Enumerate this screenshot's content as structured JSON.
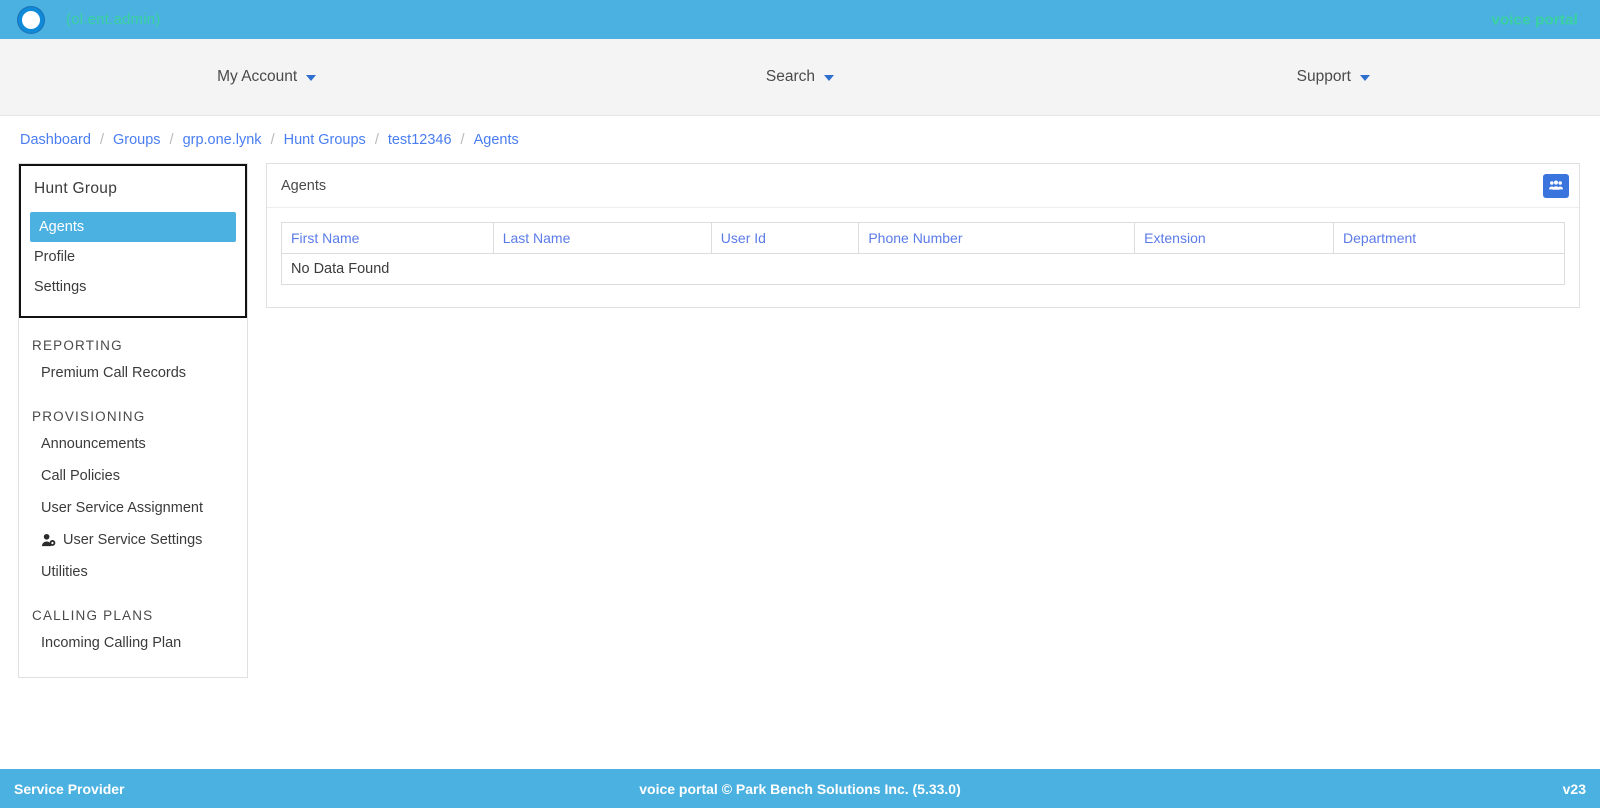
{
  "topbar": {
    "user_label": "(ol.ent.admin)",
    "brand_right": "voice portal",
    "logo_icon": "circle-logo-icon"
  },
  "mainnav": {
    "items": [
      {
        "label": "My Account",
        "icon": "chevron-down-icon"
      },
      {
        "label": "Search",
        "icon": "chevron-down-icon"
      },
      {
        "label": "Support",
        "icon": "chevron-down-icon"
      }
    ]
  },
  "breadcrumb": {
    "separator": "/",
    "items": [
      {
        "label": "Dashboard"
      },
      {
        "label": "Groups"
      },
      {
        "label": "grp.one.lynk"
      },
      {
        "label": "Hunt Groups"
      },
      {
        "label": "test12346"
      },
      {
        "label": "Agents"
      }
    ]
  },
  "sidebar": {
    "group_title": "Hunt Group",
    "group_links": [
      {
        "label": "Agents",
        "active": true
      },
      {
        "label": "Profile",
        "active": false
      },
      {
        "label": "Settings",
        "active": false
      }
    ],
    "sections": [
      {
        "title": "REPORTING",
        "items": [
          {
            "label": "Premium Call Records",
            "icon": null
          }
        ]
      },
      {
        "title": "PROVISIONING",
        "items": [
          {
            "label": "Announcements",
            "icon": null
          },
          {
            "label": "Call Policies",
            "icon": null
          },
          {
            "label": "User Service Assignment",
            "icon": null
          },
          {
            "label": "User Service Settings",
            "icon": "user-gear-icon"
          },
          {
            "label": "Utilities",
            "icon": null
          }
        ]
      },
      {
        "title": "CALLING PLANS",
        "items": [
          {
            "label": "Incoming Calling Plan",
            "icon": null
          }
        ]
      }
    ]
  },
  "panel": {
    "title": "Agents",
    "action_button": {
      "name": "assign-agents-button",
      "icon": "people-group-icon"
    },
    "table": {
      "columns": [
        "First Name",
        "Last Name",
        "User Id",
        "Phone Number",
        "Extension",
        "Department"
      ],
      "empty_message": "No Data Found",
      "rows": []
    }
  },
  "footer": {
    "left": "Service Provider",
    "center": "voice portal © Park Bench Solutions Inc. (5.33.0)",
    "right": "v23"
  },
  "colors": {
    "brand_blue": "#4bb1e0",
    "brand_green": "#3ad29f",
    "link_blue": "#4a7ef0",
    "header_blue": "#5b7be8",
    "action_blue": "#3a74dd"
  }
}
